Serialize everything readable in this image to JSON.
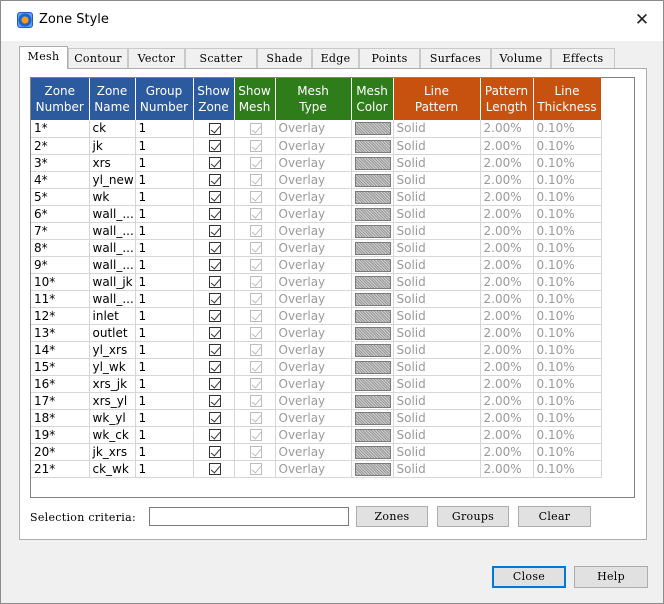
{
  "window": {
    "title": "Zone Style",
    "close_glyph": "✕"
  },
  "tabs": [
    "Mesh",
    "Contour",
    "Vector",
    "Scatter",
    "Shade",
    "Edge",
    "Points",
    "Surfaces",
    "Volume",
    "Effects"
  ],
  "active_tab": "Mesh",
  "columns": [
    {
      "line1": "Zone",
      "line2": "Number",
      "group": "blue"
    },
    {
      "line1": "Zone",
      "line2": "Name",
      "group": "blue"
    },
    {
      "line1": "Group",
      "line2": "Number",
      "group": "blue"
    },
    {
      "line1": "Show",
      "line2": "Zone",
      "group": "blue"
    },
    {
      "line1": "Show",
      "line2": "Mesh",
      "group": "green"
    },
    {
      "line1": "Mesh",
      "line2": "Type",
      "group": "green"
    },
    {
      "line1": "Mesh",
      "line2": "Color",
      "group": "green"
    },
    {
      "line1": "Line",
      "line2": "Pattern",
      "group": "orange"
    },
    {
      "line1": "Pattern",
      "line2": "Length",
      "group": "orange"
    },
    {
      "line1": "Line",
      "line2": "Thickness",
      "group": "orange"
    }
  ],
  "rows": [
    {
      "num": "1*",
      "name": "ck",
      "group": "1"
    },
    {
      "num": "2*",
      "name": "jk",
      "group": "1"
    },
    {
      "num": "3*",
      "name": "xrs",
      "group": "1"
    },
    {
      "num": "4*",
      "name": "yl_new",
      "group": "1"
    },
    {
      "num": "5*",
      "name": "wk",
      "group": "1"
    },
    {
      "num": "6*",
      "name": "wall_...",
      "group": "1"
    },
    {
      "num": "7*",
      "name": "wall_...",
      "group": "1"
    },
    {
      "num": "8*",
      "name": "wall_...",
      "group": "1"
    },
    {
      "num": "9*",
      "name": "wall_...",
      "group": "1"
    },
    {
      "num": "10*",
      "name": "wall_jk",
      "group": "1"
    },
    {
      "num": "11*",
      "name": "wall_...",
      "group": "1"
    },
    {
      "num": "12*",
      "name": "inlet",
      "group": "1"
    },
    {
      "num": "13*",
      "name": "outlet",
      "group": "1"
    },
    {
      "num": "14*",
      "name": "yl_xrs",
      "group": "1"
    },
    {
      "num": "15*",
      "name": "yl_wk",
      "group": "1"
    },
    {
      "num": "16*",
      "name": "xrs_jk",
      "group": "1"
    },
    {
      "num": "17*",
      "name": "xrs_yl",
      "group": "1"
    },
    {
      "num": "18*",
      "name": "wk_yl",
      "group": "1"
    },
    {
      "num": "19*",
      "name": "wk_ck",
      "group": "1"
    },
    {
      "num": "20*",
      "name": "jk_xrs",
      "group": "1"
    },
    {
      "num": "21*",
      "name": "ck_wk",
      "group": "1"
    }
  ],
  "row_defaults": {
    "show_zone": true,
    "show_mesh": true,
    "mesh_type": "Overlay",
    "line_pattern": "Solid",
    "pattern_length": "2.00%",
    "line_thickness": "0.10%"
  },
  "selection": {
    "label": "Selection criteria:",
    "value": ""
  },
  "buttons": {
    "zones": "Zones",
    "groups": "Groups",
    "clear": "Clear",
    "close": "Close",
    "help": "Help"
  },
  "colors": {
    "header_blue": "#2c5a9e",
    "header_green": "#2e7d1a",
    "header_orange": "#c7510e",
    "default_button_border": "#0078d7"
  }
}
